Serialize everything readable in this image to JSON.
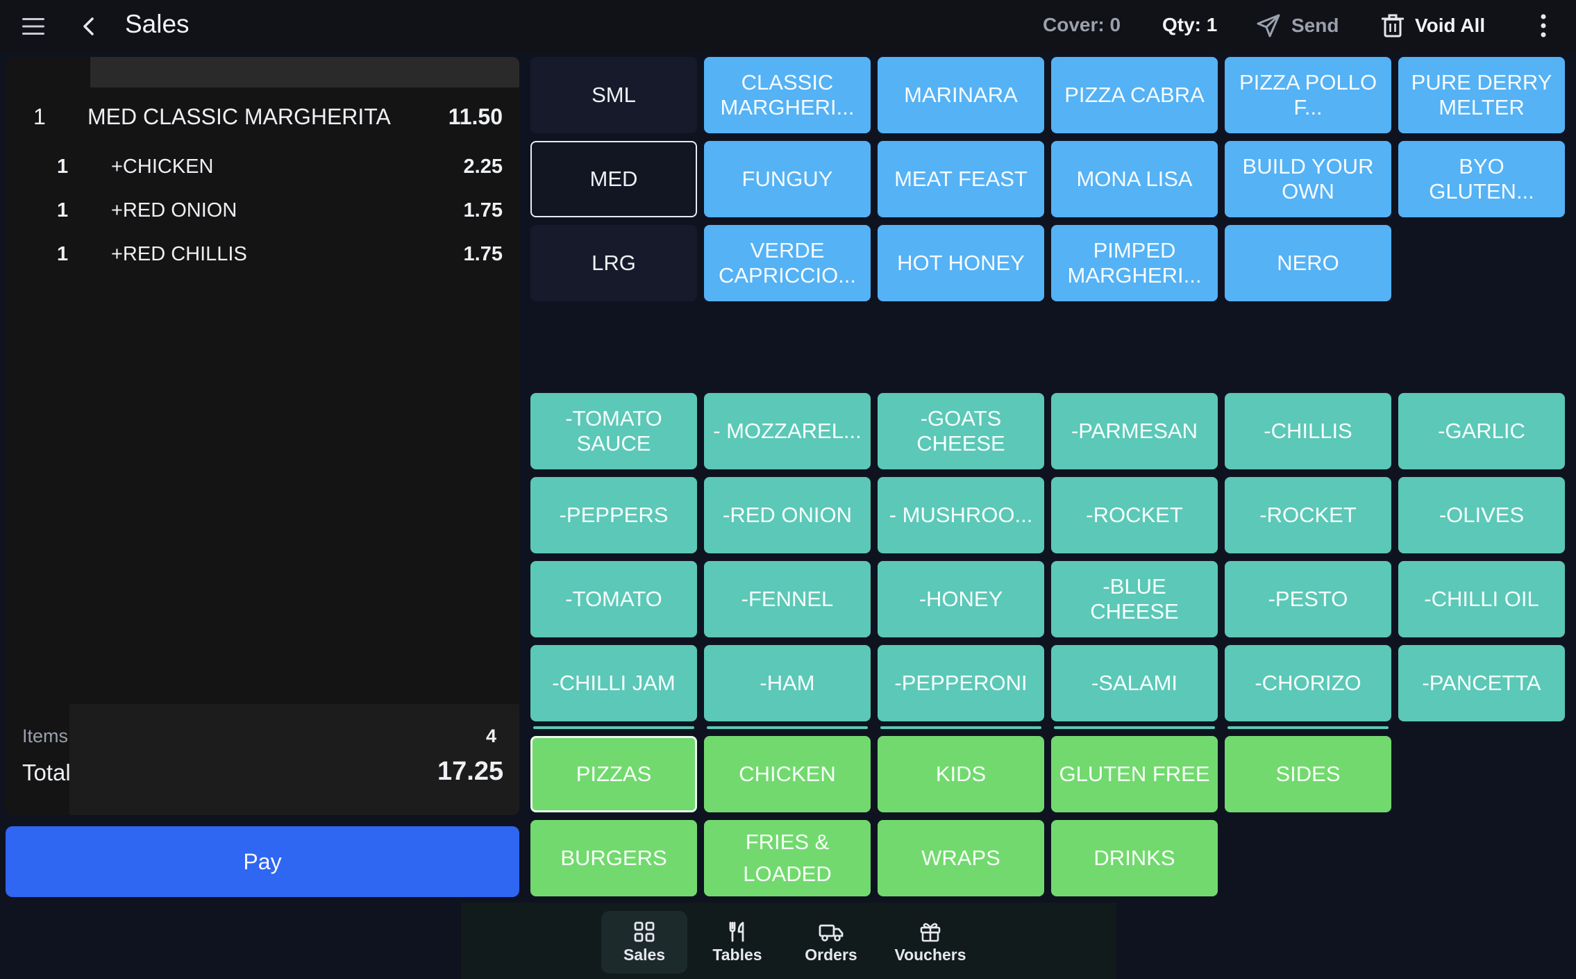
{
  "header": {
    "title": "Sales",
    "cover": "Cover: 0",
    "qty": "Qty: 1",
    "send_label": "Send",
    "void_label": "Void All",
    "icons": [
      "menu-icon",
      "back-icon",
      "send-icon",
      "trash-icon",
      "more-vertical-icon"
    ]
  },
  "order": {
    "lines": [
      {
        "qty": "1",
        "name": "MED CLASSIC MARGHERITA",
        "price": "11.50"
      },
      {
        "qty": "1",
        "name": "+CHICKEN",
        "price": "2.25"
      },
      {
        "qty": "1",
        "name": "+RED ONION",
        "price": "1.75"
      },
      {
        "qty": "1",
        "name": "+RED CHILLIS",
        "price": "1.75"
      }
    ],
    "items_label": "Items",
    "items_count": "4",
    "total_label": "Total",
    "total_value": "17.25",
    "pay_label": "Pay"
  },
  "sizes": [
    "SML",
    "MED",
    "LRG"
  ],
  "selected_size": "MED",
  "products": [
    "CLASSIC MARGHERI...",
    "MARINARA",
    "PIZZA CABRA",
    "PIZZA POLLO F...",
    "PURE DERRY MELTER",
    "FUNGUY",
    "MEAT FEAST",
    "MONA LISA",
    "BUILD YOUR OWN",
    "BYO GLUTEN...",
    "VERDE CAPRICCIO...",
    "HOT HONEY",
    "PIMPED MARGHERI...",
    "NERO"
  ],
  "modifiers": [
    "-TOMATO SAUCE",
    "- MOZZAREL...",
    "-GOATS CHEESE",
    "-PARMESAN",
    "-CHILLIS",
    "-GARLIC",
    "-PEPPERS",
    "-RED ONION",
    "- MUSHROO...",
    "-ROCKET",
    "-ROCKET",
    "-OLIVES",
    "-TOMATO",
    "-FENNEL",
    "-HONEY",
    "-BLUE CHEESE",
    "-PESTO",
    "-CHILLI OIL",
    "-CHILLI JAM",
    "-HAM",
    "-PEPPERONI",
    "-SALAMI",
    "-CHORIZO",
    "-PANCETTA"
  ],
  "categories": [
    "PIZZAS",
    "CHICKEN",
    "KIDS",
    "GLUTEN FREE",
    "SIDES",
    "BURGERS",
    "FRIES & LOADED",
    "WRAPS",
    "DRINKS"
  ],
  "selected_category": "PIZZAS",
  "nav": [
    {
      "label": "Sales",
      "icon": "grid-icon",
      "active": true
    },
    {
      "label": "Tables",
      "icon": "cutlery-icon",
      "active": false
    },
    {
      "label": "Orders",
      "icon": "delivery-truck-icon",
      "active": false
    },
    {
      "label": "Vouchers",
      "icon": "gift-icon",
      "active": false
    }
  ],
  "colors": {
    "product": "#54b2f5",
    "modifier": "#5cc8b7",
    "category": "#72d96f",
    "pay": "#2f66f2"
  }
}
